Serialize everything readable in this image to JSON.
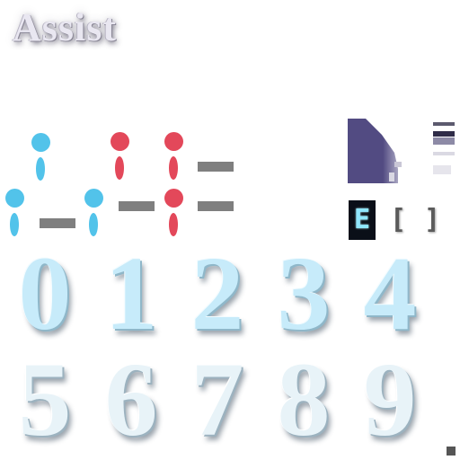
{
  "title": "Assist",
  "glyphs": {
    "e": "E",
    "left_bracket": "[",
    "right_bracket": "]"
  },
  "digits_row1": [
    "0",
    "1",
    "2",
    "3",
    "4"
  ],
  "digits_row2": [
    "5",
    "6",
    "7",
    "8",
    "9"
  ],
  "colors": {
    "pin_blue": "#52c3ea",
    "pin_red": "#e3485a",
    "dash_gray": "#7f7f7f",
    "corner_purple": "#524b82",
    "digit_top": "#c7ebfa",
    "digit_bottom": "#e8f3f8"
  }
}
